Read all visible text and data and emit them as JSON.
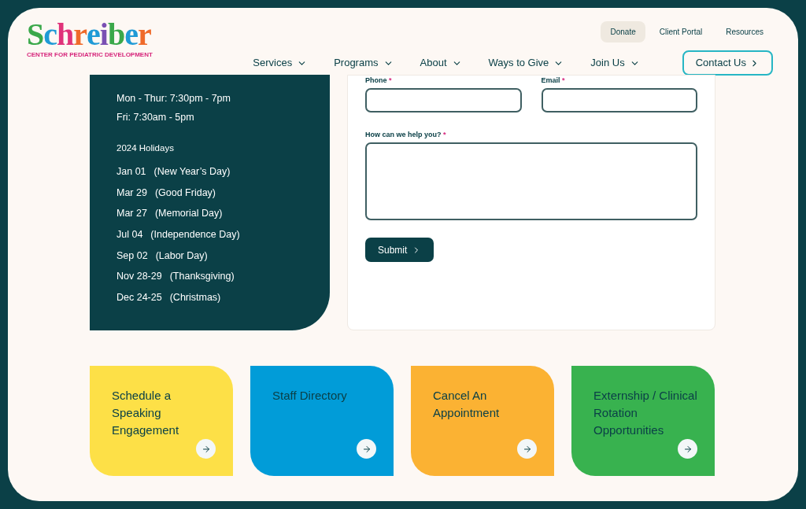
{
  "logo": {
    "letters": [
      {
        "char": "S",
        "color": "#3aa84a"
      },
      {
        "char": "c",
        "color": "#1f9ad6"
      },
      {
        "char": "h",
        "color": "#e0327a"
      },
      {
        "char": "r",
        "color": "#ef6a2a"
      },
      {
        "char": "e",
        "color": "#1f9ad6"
      },
      {
        "char": "i",
        "color": "#7a4fb3"
      },
      {
        "char": "b",
        "color": "#3aa84a"
      },
      {
        "char": "e",
        "color": "#1f9ad6"
      },
      {
        "char": "r",
        "color": "#ef6a2a"
      }
    ],
    "tagline": "CENTER FOR PEDIATRIC DEVELOPMENT"
  },
  "utility_nav": [
    {
      "label": "Donate",
      "selected": true
    },
    {
      "label": "Client Portal",
      "selected": false
    },
    {
      "label": "Resources",
      "selected": false
    }
  ],
  "main_nav": [
    "Services",
    "Programs",
    "About",
    "Ways to Give",
    "Join Us"
  ],
  "contact_button": "Contact Us",
  "hours": [
    "Mon - Thur: 7:30pm - 7pm",
    "Fri: 7:30am - 5pm"
  ],
  "holidays_title": "2024 Holidays",
  "holidays": [
    {
      "date": "Jan 01",
      "name": "(New Year’s Day)"
    },
    {
      "date": "Mar 29",
      "name": "(Good Friday)"
    },
    {
      "date": "Mar 27",
      "name": "(Memorial Day)"
    },
    {
      "date": "Jul 04",
      "name": "(Independence Day)"
    },
    {
      "date": "Sep 02",
      "name": "(Labor Day)"
    },
    {
      "date": "Nov 28-29",
      "name": "(Thanksgiving)"
    },
    {
      "date": "Dec 24-25",
      "name": "(Christmas)"
    }
  ],
  "form": {
    "fields": [
      {
        "label": "Phone",
        "required": "*"
      },
      {
        "label": "Email",
        "required": "*"
      }
    ],
    "message": {
      "label": "How can we help you?",
      "required": "*"
    },
    "submit": "Submit"
  },
  "cards": [
    {
      "title": "Schedule a Speaking Engagement",
      "color": "#fde047"
    },
    {
      "title": "Staff Directory",
      "color": "#019cd8"
    },
    {
      "title": "Cancel An Appointment",
      "color": "#fbb233"
    },
    {
      "title": "Externship / Clinical Rotation Opportunities",
      "color": "#38b24f"
    }
  ]
}
